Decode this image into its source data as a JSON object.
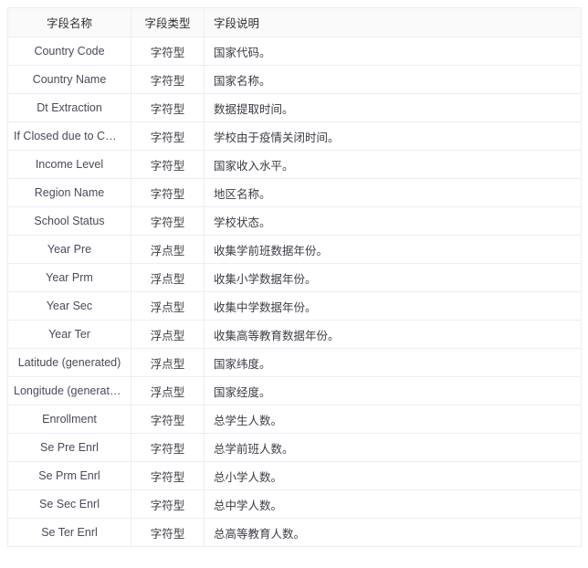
{
  "table": {
    "columns": [
      {
        "key": "name",
        "label": "字段名称"
      },
      {
        "key": "type",
        "label": "字段类型"
      },
      {
        "key": "desc",
        "label": "字段说明"
      }
    ],
    "rows": [
      {
        "name": "Country Code",
        "type": "字符型",
        "desc": "国家代码。"
      },
      {
        "name": "Country Name",
        "type": "字符型",
        "desc": "国家名称。"
      },
      {
        "name": "Dt Extraction",
        "type": "字符型",
        "desc": "数据提取时间。"
      },
      {
        "name": "If Closed due to COVID...",
        "type": "字符型",
        "desc": "学校由于疫情关闭时间。"
      },
      {
        "name": "Income Level",
        "type": "字符型",
        "desc": "国家收入水平。"
      },
      {
        "name": "Region Name",
        "type": "字符型",
        "desc": "地区名称。"
      },
      {
        "name": "School Status",
        "type": "字符型",
        "desc": "学校状态。"
      },
      {
        "name": "Year Pre",
        "type": "浮点型",
        "desc": "收集学前班数据年份。"
      },
      {
        "name": "Year Prm",
        "type": "浮点型",
        "desc": "收集小学数据年份。"
      },
      {
        "name": "Year Sec",
        "type": "浮点型",
        "desc": "收集中学数据年份。"
      },
      {
        "name": "Year Ter",
        "type": "浮点型",
        "desc": "收集高等教育数据年份。"
      },
      {
        "name": "Latitude (generated)",
        "type": "浮点型",
        "desc": "国家纬度。"
      },
      {
        "name": "Longitude (generated)",
        "type": "浮点型",
        "desc": "国家经度。"
      },
      {
        "name": "Enrollment",
        "type": "字符型",
        "desc": "总学生人数。"
      },
      {
        "name": "Se Pre Enrl",
        "type": "字符型",
        "desc": "总学前班人数。"
      },
      {
        "name": "Se Prm Enrl",
        "type": "字符型",
        "desc": "总小学人数。"
      },
      {
        "name": "Se Sec Enrl",
        "type": "字符型",
        "desc": "总中学人数。"
      },
      {
        "name": "Se Ter Enrl",
        "type": "字符型",
        "desc": "总高等教育人数。"
      }
    ]
  },
  "colors": {
    "header_bg": "#fafafa",
    "border": "#ebeef5",
    "text": "#3c3c46",
    "name_text": "#4a4a5a"
  }
}
